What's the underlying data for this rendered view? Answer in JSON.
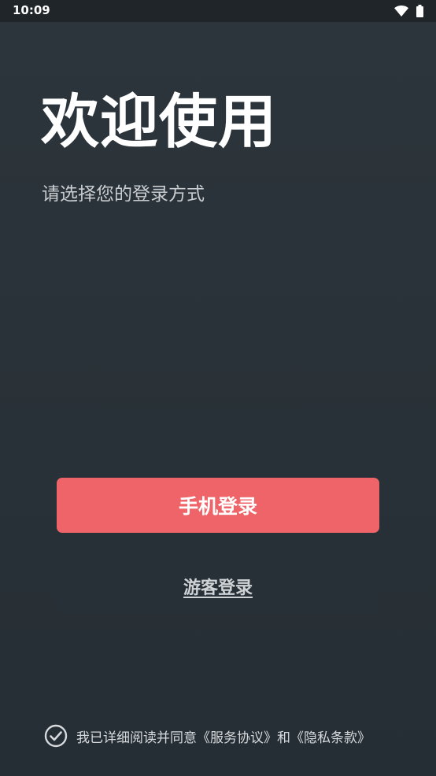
{
  "status_bar": {
    "time": "10:09",
    "icons": [
      "wifi-icon",
      "battery-icon"
    ]
  },
  "welcome": {
    "title": "欢迎使用",
    "subtitle": "请选择您的登录方式"
  },
  "buttons": {
    "phone_login": "手机登录",
    "guest_login": "游客登录"
  },
  "agreement": {
    "checked": true,
    "prefix": "我已详细阅读并同意",
    "service_link": "《服务协议》",
    "conjunction": "和",
    "privacy_link": "《隐私条款》"
  },
  "colors": {
    "background": "#2b333a",
    "primary_button": "#ee6468",
    "text_muted": "#c9cdd0"
  }
}
